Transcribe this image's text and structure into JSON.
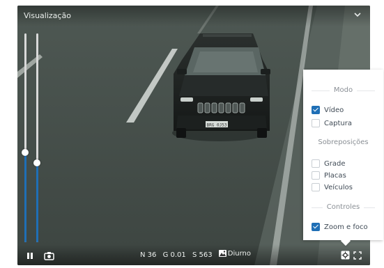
{
  "viewer": {
    "title": "Visualização",
    "plate_text": "BRG 0J53"
  },
  "sliders": [
    {
      "level": 0.43
    },
    {
      "level": 0.38
    }
  ],
  "stats": {
    "n": "N 36",
    "g": "G 0.01",
    "s": "S 563",
    "mode": "Diurno"
  },
  "panel": {
    "mode_title": "Modo",
    "overlays_title": "Sobreposições",
    "controls_title": "Controles",
    "mode_options": [
      {
        "label": "Vídeo",
        "checked": true
      },
      {
        "label": "Captura",
        "checked": false
      }
    ],
    "overlay_options": [
      {
        "label": "Grade",
        "checked": false
      },
      {
        "label": "Placas",
        "checked": false
      },
      {
        "label": "Veículos",
        "checked": false
      }
    ],
    "control_options": [
      {
        "label": "Zoom e foco",
        "checked": true
      }
    ]
  },
  "colors": {
    "accent": "#1f6fb6"
  },
  "icons": {
    "pause": "pause-icon",
    "camera": "camera-icon",
    "settings": "settings-icon",
    "fullscreen": "fullscreen-icon",
    "chevron": "chevron-down-icon",
    "mode": "day-mode-icon"
  }
}
